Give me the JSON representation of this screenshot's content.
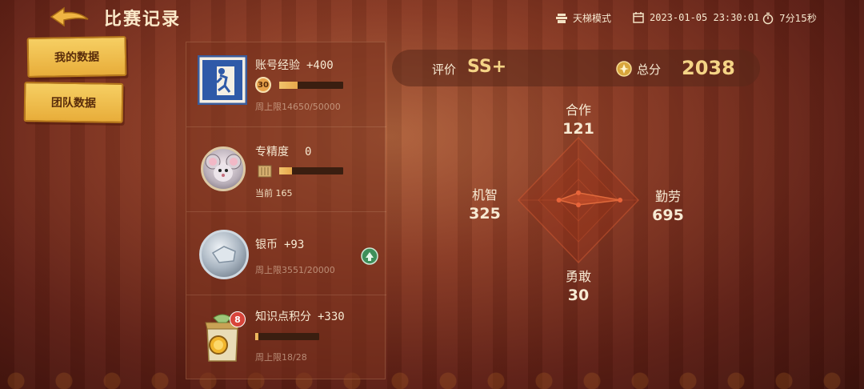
{
  "header": {
    "title": "比赛记录",
    "mode": "天梯模式",
    "datetime": "2023-01-05 23:30:01",
    "duration": "7分15秒"
  },
  "nav": {
    "my_data": "我的数据",
    "team_data": "团队数据"
  },
  "rewards": {
    "account_exp": {
      "label": "账号经验",
      "value": "+400",
      "level": "30",
      "progress_text": "周上限14650/50000",
      "progress": 0.29
    },
    "mastery": {
      "label": "专精度",
      "value": "0",
      "current_text": "当前 165",
      "progress": 0.2
    },
    "silver": {
      "label": "银币",
      "value": "+93",
      "progress_text": "周上限3551/20000"
    },
    "knowledge": {
      "label": "知识点积分",
      "value": "+330",
      "badge": "8",
      "progress_text": "周上限18/28",
      "progress": 0.05
    }
  },
  "score": {
    "rating_label": "评价",
    "rating": "SS+",
    "total_label": "总分",
    "total": "2038"
  },
  "radar": {
    "cooperation": {
      "label": "合作",
      "value": "121"
    },
    "diligence": {
      "label": "勤劳",
      "value": "695"
    },
    "bravery": {
      "label": "勇敢",
      "value": "30"
    },
    "wit": {
      "label": "机智",
      "value": "325"
    }
  },
  "colors": {
    "accent_gold": "#f5d486",
    "button_gold": "#f0c050",
    "radar_fill": "#c8502a"
  }
}
